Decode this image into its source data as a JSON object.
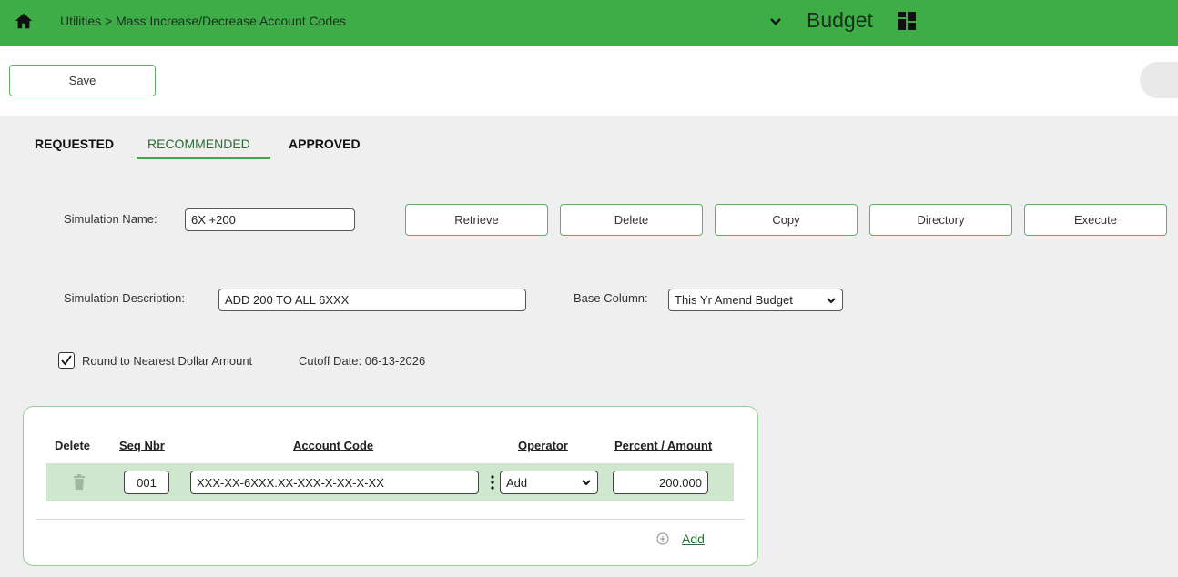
{
  "header": {
    "breadcrumb": "Utilities > Mass Increase/Decrease Account Codes",
    "app_name": "Budget",
    "bar_color": "#3fad47"
  },
  "toolbar": {
    "save_label": "Save"
  },
  "tabs": [
    {
      "label": "REQUESTED",
      "active": false
    },
    {
      "label": "RECOMMENDED",
      "active": true
    },
    {
      "label": "APPROVED",
      "active": false
    }
  ],
  "form": {
    "sim_name_label": "Simulation Name:",
    "sim_name_value": "6X +200",
    "sim_desc_label": "Simulation Description:",
    "sim_desc_value": "ADD 200 TO ALL 6XXX",
    "base_column_label": "Base Column:",
    "base_column_value": "This Yr Amend Budget",
    "round_label": "Round to Nearest Dollar Amount",
    "round_checked": true,
    "cutoff_label": "Cutoff Date: 06-13-2026"
  },
  "actions": {
    "retrieve": "Retrieve",
    "delete": "Delete",
    "copy": "Copy",
    "directory": "Directory",
    "execute": "Execute"
  },
  "grid": {
    "columns": {
      "delete": "Delete",
      "seq_nbr": "Seq Nbr",
      "account_code": "Account Code",
      "operator": "Operator",
      "percent_amount": "Percent / Amount"
    },
    "rows": [
      {
        "seq_nbr": "001",
        "account_code": "XXX-XX-6XXX.XX-XXX-X-XX-X-XX",
        "operator": "Add",
        "percent_amount": "200.000"
      }
    ],
    "add_label": "Add"
  },
  "icons": {
    "home": "home-icon",
    "chevron": "chevron-down-icon",
    "apps": "grid-icon",
    "trash": "trash-icon",
    "add": "plus-circle-icon"
  }
}
